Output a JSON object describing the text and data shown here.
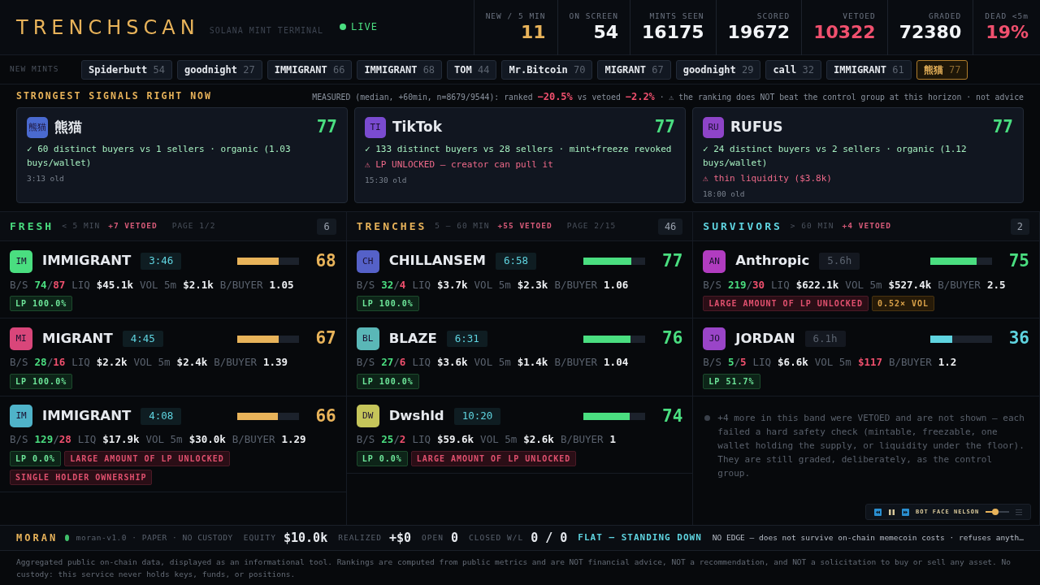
{
  "header": {
    "logo": "TRENCHSCAN",
    "subtitle": "SOLANA MINT TERMINAL",
    "live": {
      "label": "LIVE",
      "on": true
    },
    "stats": [
      {
        "label": "NEW / 5 MIN",
        "value": "11",
        "color": "#e8b35a"
      },
      {
        "label": "ON SCREEN",
        "value": "54",
        "color": "#f2f4f7"
      },
      {
        "label": "MINTS SEEN",
        "value": "16175",
        "color": "#f2f4f7"
      },
      {
        "label": "SCORED",
        "value": "19672",
        "color": "#f2f4f7"
      },
      {
        "label": "VETOED",
        "value": "10322",
        "color": "#f0506e"
      },
      {
        "label": "GRADED",
        "value": "72380",
        "color": "#f2f4f7"
      },
      {
        "label": "DEAD <5m",
        "value": "19%",
        "color": "#f0506e"
      }
    ]
  },
  "ticker": {
    "label": "NEW MINTS",
    "chips": [
      {
        "name": "Spiderbutt",
        "score": "54",
        "selected": false
      },
      {
        "name": "goodnight",
        "score": "27",
        "selected": false
      },
      {
        "name": "IMMIGRANT",
        "score": "66",
        "selected": false
      },
      {
        "name": "IMMIGRANT",
        "score": "68",
        "selected": false
      },
      {
        "name": "TOM",
        "score": "44",
        "selected": false
      },
      {
        "name": "Mr.Bitcoin",
        "score": "70",
        "selected": false
      },
      {
        "name": "MIGRANT",
        "score": "67",
        "selected": false
      },
      {
        "name": "goodnight",
        "score": "29",
        "selected": false
      },
      {
        "name": "call",
        "score": "32",
        "selected": false
      },
      {
        "name": "IMMIGRANT",
        "score": "61",
        "selected": false
      },
      {
        "name": "熊猫",
        "score": "77",
        "selected": true
      }
    ]
  },
  "signals": {
    "title": "STRONGEST SIGNALS RIGHT NOW",
    "measured": [
      {
        "text": "MEASURED (median, +60min, n=8679/9544): ranked ",
        "kind": "plain"
      },
      {
        "text": "−20.5%",
        "kind": "bad"
      },
      {
        "text": " vs vetoed ",
        "kind": "plain"
      },
      {
        "text": "−2.2%",
        "kind": "bad"
      },
      {
        "text": " · ⚠ the ranking does NOT beat the control group at this horizon · not advice",
        "kind": "plain"
      }
    ],
    "cards": [
      {
        "avatar": {
          "text": "熊猫",
          "color": "#4a6ad0"
        },
        "name": "熊猫",
        "score": "77",
        "lines": [
          {
            "text": "✓ 60 distinct buyers vs 1 sellers · organic (1.03 buys/wallet)",
            "kind": "ok"
          }
        ],
        "age": "3:13 old"
      },
      {
        "avatar": {
          "text": "TI",
          "color": "#7a4bd0"
        },
        "name": "TikTok",
        "score": "77",
        "lines": [
          {
            "text": "✓ 133 distinct buyers vs 28 sellers · mint+freeze revoked",
            "kind": "ok"
          },
          {
            "text": "⚠ LP UNLOCKED — creator can pull it",
            "kind": "warn"
          }
        ],
        "age": "15:30 old"
      },
      {
        "avatar": {
          "text": "RU",
          "color": "#8e44c8"
        },
        "name": "RUFUS",
        "score": "77",
        "lines": [
          {
            "text": "✓ 24 distinct buyers vs 2 sellers · organic (1.12 buys/wallet)",
            "kind": "ok"
          },
          {
            "text": "⚠ thin liquidity ($3.8k)",
            "kind": "warn"
          }
        ],
        "age": "18:00 old"
      }
    ]
  },
  "columns": [
    {
      "title": "FRESH",
      "color": "#4ade80",
      "range": "< 5 MIN",
      "vetoed": "+7 VETOED",
      "page": "PAGE 1/2",
      "count": "6",
      "rows": [
        {
          "avatar": {
            "text": "IM",
            "color": "#4ade80"
          },
          "name": "IMMIGRANT",
          "age": "3:46",
          "ticking": true,
          "level": 0.68,
          "score": "68",
          "color": "#e8b35a",
          "metrics": [
            {
              "kind": "ratio",
              "label": "B/S",
              "buys": "74",
              "separator": "/",
              "sells": "87"
            },
            {
              "kind": "value",
              "label": "LIQ",
              "value": "$45.1k"
            },
            {
              "kind": "value",
              "label": "VOL 5m",
              "value": "$2.1k"
            },
            {
              "kind": "value",
              "label": "B/BUYER",
              "value": "1.05"
            }
          ],
          "tags": [
            {
              "text": "LP 100.0%",
              "kind": "ok"
            }
          ]
        },
        {
          "avatar": {
            "text": "MI",
            "color": "#d9467a"
          },
          "name": "MIGRANT",
          "age": "4:45",
          "ticking": true,
          "level": 0.67,
          "score": "67",
          "color": "#e8b35a",
          "metrics": [
            {
              "kind": "ratio",
              "label": "B/S",
              "buys": "28",
              "separator": "/",
              "sells": "16"
            },
            {
              "kind": "value",
              "label": "LIQ",
              "value": "$2.2k"
            },
            {
              "kind": "value",
              "label": "VOL 5m",
              "value": "$2.4k"
            },
            {
              "kind": "value",
              "label": "B/BUYER",
              "value": "1.39"
            }
          ],
          "tags": [
            {
              "text": "LP 100.0%",
              "kind": "ok"
            }
          ]
        },
        {
          "avatar": {
            "text": "IM",
            "color": "#4fb3c9"
          },
          "name": "IMMIGRANT",
          "age": "4:08",
          "ticking": true,
          "level": 0.66,
          "score": "66",
          "color": "#e8b35a",
          "metrics": [
            {
              "kind": "ratio",
              "label": "B/S",
              "buys": "129",
              "separator": "/",
              "sells": "28"
            },
            {
              "kind": "value",
              "label": "LIQ",
              "value": "$17.9k"
            },
            {
              "kind": "value",
              "label": "VOL 5m",
              "value": "$30.0k"
            },
            {
              "kind": "value",
              "label": "B/BUYER",
              "value": "1.29"
            }
          ],
          "tags": [
            {
              "text": "LP 0.0%",
              "kind": "ok"
            },
            {
              "text": "LARGE AMOUNT OF LP UNLOCKED",
              "kind": "danger"
            },
            {
              "text": "SINGLE HOLDER OWNERSHIP",
              "kind": "danger"
            }
          ]
        }
      ]
    },
    {
      "title": "TRENCHES",
      "color": "#e8b35a",
      "range": "5 – 60 MIN",
      "vetoed": "+55 VETOED",
      "page": "PAGE 2/15",
      "count": "46",
      "rows": [
        {
          "avatar": {
            "text": "CH",
            "color": "#5561c8"
          },
          "name": "CHILLANSEM",
          "age": "6:58",
          "ticking": true,
          "level": 0.77,
          "score": "77",
          "color": "#4ade80",
          "metrics": [
            {
              "kind": "ratio",
              "label": "B/S",
              "buys": "32",
              "separator": "/",
              "sells": "4"
            },
            {
              "kind": "value",
              "label": "LIQ",
              "value": "$3.7k"
            },
            {
              "kind": "value",
              "label": "VOL 5m",
              "value": "$2.3k"
            },
            {
              "kind": "value",
              "label": "B/BUYER",
              "value": "1.06"
            }
          ],
          "tags": [
            {
              "text": "LP 100.0%",
              "kind": "ok"
            }
          ]
        },
        {
          "avatar": {
            "text": "BL",
            "color": "#5ab7b7"
          },
          "name": "BLAZE",
          "age": "6:31",
          "ticking": true,
          "level": 0.76,
          "score": "76",
          "color": "#4ade80",
          "metrics": [
            {
              "kind": "ratio",
              "label": "B/S",
              "buys": "27",
              "separator": "/",
              "sells": "6"
            },
            {
              "kind": "value",
              "label": "LIQ",
              "value": "$3.6k"
            },
            {
              "kind": "value",
              "label": "VOL 5m",
              "value": "$1.4k"
            },
            {
              "kind": "value",
              "label": "B/BUYER",
              "value": "1.04"
            }
          ],
          "tags": [
            {
              "text": "LP 100.0%",
              "kind": "ok"
            }
          ]
        },
        {
          "avatar": {
            "text": "DW",
            "color": "#c5c55a"
          },
          "name": "Dwshld",
          "age": "10:20",
          "ticking": true,
          "level": 0.74,
          "score": "74",
          "color": "#4ade80",
          "metrics": [
            {
              "kind": "ratio",
              "label": "B/S",
              "buys": "25",
              "separator": "/",
              "sells": "2"
            },
            {
              "kind": "value",
              "label": "LIQ",
              "value": "$59.6k"
            },
            {
              "kind": "value",
              "label": "VOL 5m",
              "value": "$2.6k"
            },
            {
              "kind": "value",
              "label": "B/BUYER",
              "value": "1"
            }
          ],
          "tags": [
            {
              "text": "LP 0.0%",
              "kind": "ok"
            },
            {
              "text": "LARGE AMOUNT OF LP UNLOCKED",
              "kind": "danger"
            }
          ]
        }
      ]
    },
    {
      "title": "SURVIVORS",
      "color": "#5fd4e0",
      "range": "> 60 MIN",
      "vetoed": "+4 VETOED",
      "count": "2",
      "rows": [
        {
          "avatar": {
            "text": "AN",
            "color": "#b13cc0"
          },
          "name": "Anthropic",
          "age": "5.6h",
          "ticking": false,
          "level": 0.75,
          "score": "75",
          "color": "#4ade80",
          "metrics": [
            {
              "kind": "ratio",
              "label": "B/S",
              "buys": "219",
              "separator": "/",
              "sells": "30"
            },
            {
              "kind": "value",
              "label": "LIQ",
              "value": "$622.1k"
            },
            {
              "kind": "value",
              "label": "VOL 5m",
              "value": "$527.4k"
            },
            {
              "kind": "value",
              "label": "B/BUYER",
              "value": "2.5"
            }
          ],
          "tags": [
            {
              "text": "LARGE AMOUNT OF LP UNLOCKED",
              "kind": "danger"
            },
            {
              "text": "0.52× VOL",
              "kind": "warn"
            }
          ]
        },
        {
          "avatar": {
            "text": "JO",
            "color": "#9a45c8"
          },
          "name": "JORDAN",
          "age": "6.1h",
          "ticking": false,
          "level": 0.36,
          "score": "36",
          "color": "#5fd4e0",
          "metrics": [
            {
              "kind": "ratio",
              "label": "B/S",
              "buys": "5",
              "separator": "/",
              "sells": "5"
            },
            {
              "kind": "value",
              "label": "LIQ",
              "value": "$6.6k"
            },
            {
              "kind": "alert",
              "label": "VOL 5m",
              "value": "$117"
            },
            {
              "kind": "value",
              "label": "B/BUYER",
              "value": "1.2"
            }
          ],
          "tags": [
            {
              "text": "LP 51.7%",
              "kind": "ok"
            }
          ]
        }
      ],
      "note": "+4 more in this band were VETOED and are not shown — each failed a hard safety check (mintable, freezable, one wallet holding the supply, or liquidity under the floor). They are still graded, deliberately, as the control group."
    }
  ],
  "player": {
    "title": "BOT FACE NELSON",
    "playing": true,
    "level": 0.4
  },
  "bot": {
    "name": "MORAN",
    "running": true,
    "meta": "moran-v1.0 · PAPER · NO CUSTODY",
    "stats": [
      {
        "label": "EQUITY",
        "value": "$10.0k"
      },
      {
        "label": "REALIZED",
        "value": "+$0"
      },
      {
        "label": "OPEN",
        "value": "0"
      },
      {
        "label": "CLOSED W/L",
        "value": "0 / 0"
      }
    ],
    "status": "FLAT — STANDING DOWN",
    "note": "NO EDGE — does not survive on-chain memecoin costs · refuses anyth…"
  },
  "disclaimer": "Aggregated public on-chain data, displayed as an informational tool. Rankings are computed from public metrics and are NOT financial advice, NOT a recommendation, and NOT a solicitation to buy or sell any asset. No custody: this service never holds keys, funds, or positions."
}
